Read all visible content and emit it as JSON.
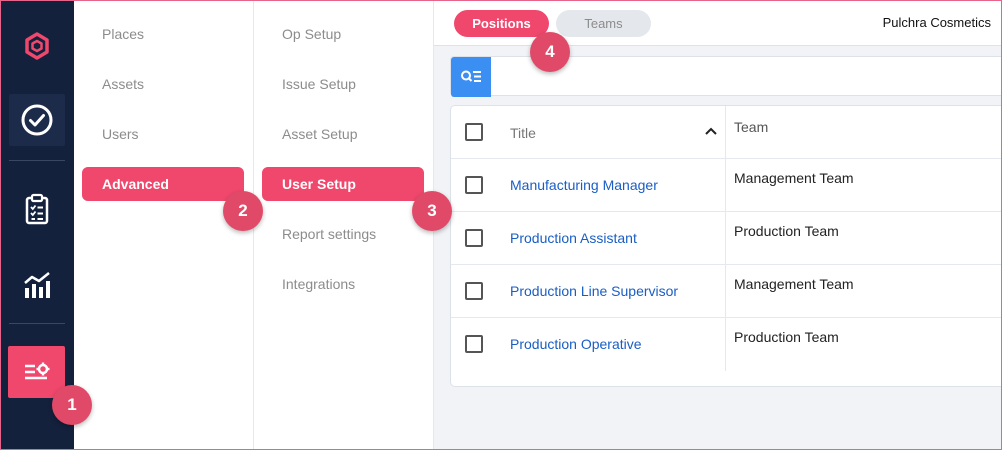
{
  "rail": {
    "icons": [
      "hexagon-logo-icon",
      "check-circle-icon",
      "clipboard-checklist-icon",
      "bar-chart-icon",
      "settings-sliders-icon"
    ]
  },
  "menu1": {
    "items": [
      {
        "label": "Places"
      },
      {
        "label": "Assets"
      },
      {
        "label": "Users"
      },
      {
        "label": "Advanced"
      }
    ]
  },
  "menu2": {
    "items": [
      {
        "label": "Op Setup"
      },
      {
        "label": "Issue Setup"
      },
      {
        "label": "Asset Setup"
      },
      {
        "label": "User Setup"
      },
      {
        "label": "Report settings"
      },
      {
        "label": "Integrations"
      }
    ]
  },
  "tabs": {
    "positions": "Positions",
    "teams": "Teams"
  },
  "company": "Pulchra Cosmetics",
  "table": {
    "headers": {
      "title": "Title",
      "team": "Team"
    },
    "rows": [
      {
        "title": "Manufacturing Manager",
        "team": "Management Team"
      },
      {
        "title": "Production Assistant",
        "team": "Production Team"
      },
      {
        "title": "Production Line Supervisor",
        "team": "Management Team"
      },
      {
        "title": "Production Operative",
        "team": "Production Team"
      }
    ]
  },
  "badges": {
    "b1": "1",
    "b2": "2",
    "b3": "3",
    "b4": "4"
  },
  "colors": {
    "accent": "#f0476d",
    "rail_bg": "#14213d",
    "link": "#1a5ec4",
    "filter_button": "#3b8ff3"
  }
}
